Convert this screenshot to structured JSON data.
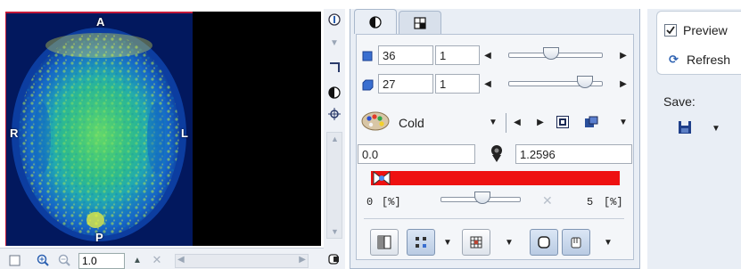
{
  "viewer": {
    "orientation": {
      "top": "A",
      "left": "R",
      "right": "L",
      "bottom": "P"
    },
    "toolbar": {
      "zoom_value": "1.0"
    }
  },
  "tabs": [
    {
      "label": "color-tab",
      "icon": "contrast-icon"
    },
    {
      "label": "layout-tab",
      "icon": "grid-icon"
    }
  ],
  "slice_controls": [
    {
      "icon": "axial-slice-icon",
      "value": "36",
      "step": "1",
      "slider_fraction": 0.45
    },
    {
      "icon": "volume-slice-icon",
      "value": "27",
      "step": "1",
      "slider_fraction": 0.85
    }
  ],
  "colormap": {
    "name": "Cold",
    "min_value": "0.0",
    "max_value": "1.2596",
    "bar_color": "#ee1111",
    "lower_percent": "0",
    "upper_percent": "5",
    "unit": "[%]",
    "threshold_slider_fraction": 0.45
  },
  "right_panel": {
    "preview_label": "Preview",
    "preview_checked": true,
    "refresh_label": "Refresh",
    "save_label": "Save:"
  },
  "colors": {
    "accent": "#2a5fb0",
    "panel_bg": "#e9eef5",
    "frame_red": "#c4193a"
  }
}
